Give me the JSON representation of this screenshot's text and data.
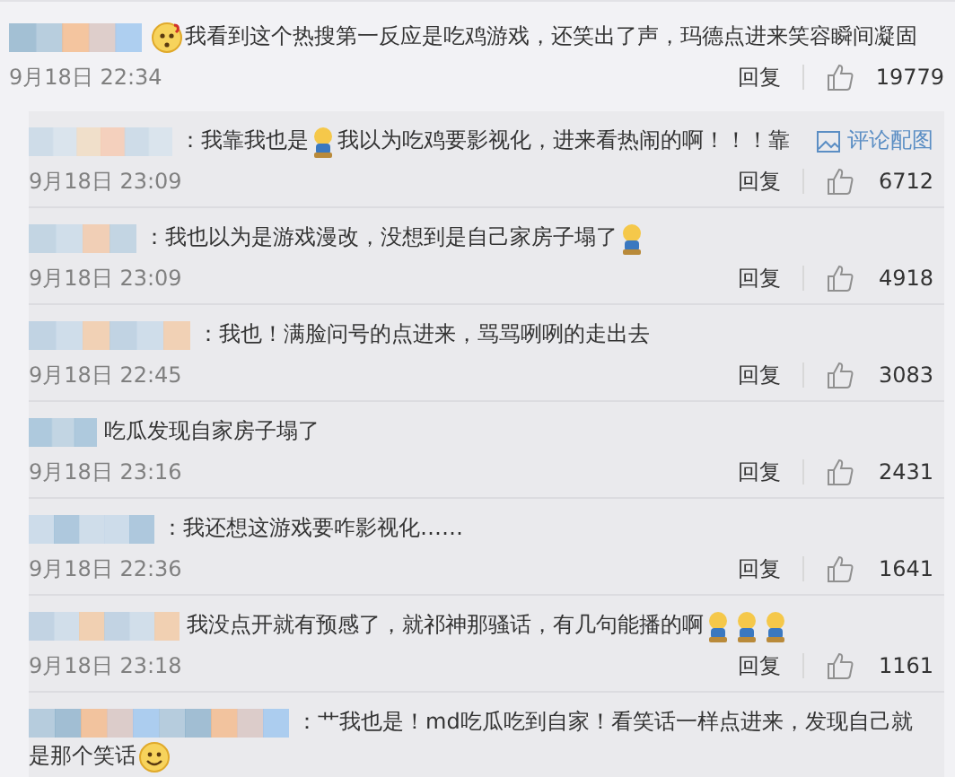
{
  "comment": {
    "segments": [
      {
        "kind": "confused"
      },
      {
        "kind": "text",
        "text": "我看到这个热搜第一反应是吃鸡游戏，还笑出了声，玛德点进来笑容瞬间凝固"
      }
    ],
    "time": "9月18日 22:34",
    "reply_label": "回复",
    "likes": "19779"
  },
  "replies": [
    {
      "segments": [
        {
          "kind": "text",
          "text": "：我靠我也是"
        },
        {
          "kind": "doll"
        },
        {
          "kind": "text",
          "text": "我以为吃鸡要影视化，进来看热闹的啊！！！靠"
        }
      ],
      "image_link": "评论配图",
      "time": "9月18日 23:09",
      "reply_label": "回复",
      "likes": "6712"
    },
    {
      "segments": [
        {
          "kind": "text",
          "text": "：我也以为是游戏漫改，没想到是自己家房子塌了"
        },
        {
          "kind": "doll"
        }
      ],
      "time": "9月18日 23:09",
      "reply_label": "回复",
      "likes": "4918"
    },
    {
      "segments": [
        {
          "kind": "text",
          "text": "：我也！满脸问号的点进来，骂骂咧咧的走出去"
        }
      ],
      "time": "9月18日 22:45",
      "reply_label": "回复",
      "likes": "3083"
    },
    {
      "segments": [
        {
          "kind": "text",
          "text": "吃瓜发现自家房子塌了"
        }
      ],
      "time": "9月18日 23:16",
      "reply_label": "回复",
      "likes": "2431"
    },
    {
      "segments": [
        {
          "kind": "text",
          "text": "：我还想这游戏要咋影视化……"
        }
      ],
      "time": "9月18日 22:36",
      "reply_label": "回复",
      "likes": "1641"
    },
    {
      "segments": [
        {
          "kind": "text",
          "text": "我没点开就有预感了，就祁神那骚话，有几句能播的啊"
        },
        {
          "kind": "doll"
        },
        {
          "kind": "doll"
        },
        {
          "kind": "doll"
        }
      ],
      "time": "9月18日 23:18",
      "reply_label": "回复",
      "likes": "1161"
    },
    {
      "segments": [
        {
          "kind": "text",
          "text": "：艹我也是！md吃瓜吃到自家！看笑话一样点进来，发现自己就"
        },
        {
          "kind": "text",
          "text": "是那个笑话",
          "new_line": true
        },
        {
          "kind": "smile"
        }
      ]
    }
  ]
}
